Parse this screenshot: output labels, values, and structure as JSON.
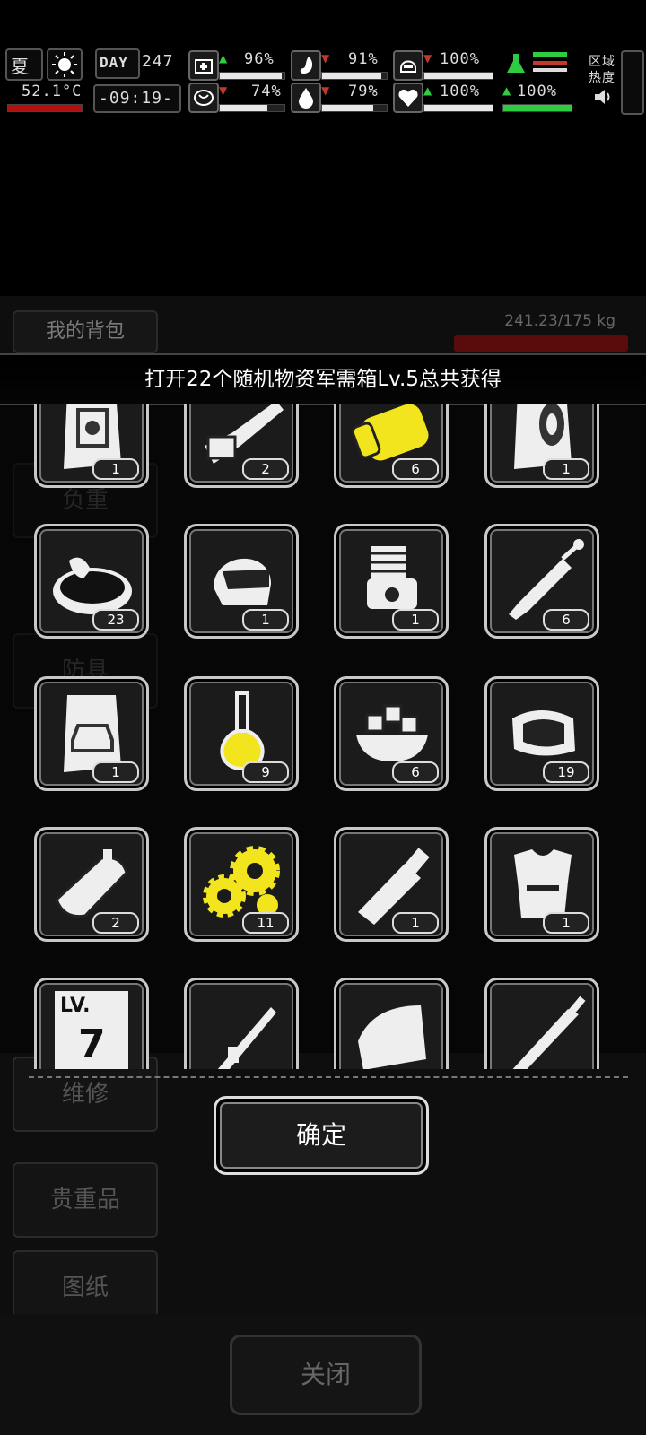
{
  "hud": {
    "season": "夏",
    "temperature": "52.1°C",
    "day_label": "DAY",
    "day_number": "247",
    "clock": "-09:19-",
    "stats": [
      {
        "name": "health",
        "icon": "medkit-icon",
        "value": "96%",
        "trend": "up",
        "color": "#e8e8e8",
        "level": 0.96
      },
      {
        "name": "hunger",
        "icon": "stomach-icon",
        "value": "91%",
        "trend": "down",
        "color": "#e8e8e8",
        "level": 0.91
      },
      {
        "name": "armor",
        "icon": "helmet-icon",
        "value": "100%",
        "trend": "down",
        "color": "#e8e8e8",
        "level": 1.0
      },
      {
        "name": "sanity",
        "icon": "brain-icon",
        "value": "74%",
        "trend": "down",
        "color": "#e8e8e8",
        "level": 0.74
      },
      {
        "name": "thirst",
        "icon": "water-drop-icon",
        "value": "79%",
        "trend": "down",
        "color": "#e8e8e8",
        "level": 0.79
      },
      {
        "name": "heart",
        "icon": "heart-icon",
        "value": "100%",
        "trend": "up",
        "color": "#e8e8e8",
        "level": 1.0
      },
      {
        "name": "infection",
        "icon": "flask-icon",
        "value": "100%",
        "trend": "up",
        "color": "#2ecc40",
        "level": 1.0
      }
    ],
    "zone_heat_label": "区域热度",
    "temperature_bar_color": "#b01010"
  },
  "background": {
    "backpack_title": "我的背包",
    "weight": "241.23/175 kg",
    "side_tabs": [
      "负重",
      "防具",
      "维修",
      "贵重品",
      "图纸"
    ],
    "close_label": "关闭"
  },
  "reward": {
    "header": "打开22个随机物资军需箱Lv.5总共获得",
    "confirm_label": "确定",
    "items": [
      {
        "icon": "engine-blueprint-icon",
        "qty": "1"
      },
      {
        "icon": "chainsaw-icon",
        "qty": "2"
      },
      {
        "icon": "yellow-cylinder-icon",
        "qty": "6"
      },
      {
        "icon": "tire-blueprint-icon",
        "qty": "1"
      },
      {
        "icon": "chicken-stew-icon",
        "qty": "23"
      },
      {
        "icon": "motorcycle-helmet-icon",
        "qty": "1"
      },
      {
        "icon": "engine-block-icon",
        "qty": "1"
      },
      {
        "icon": "syringe-icon",
        "qty": "6"
      },
      {
        "icon": "car-blueprint-icon",
        "qty": "1"
      },
      {
        "icon": "chemical-flask-icon",
        "qty": "9"
      },
      {
        "icon": "food-bowl-icon",
        "qty": "6"
      },
      {
        "icon": "raw-meat-icon",
        "qty": "19"
      },
      {
        "icon": "sardine-can-icon",
        "qty": "2"
      },
      {
        "icon": "gears-icon",
        "qty": "11"
      },
      {
        "icon": "fuel-nozzle-icon",
        "qty": "1"
      },
      {
        "icon": "body-armor-icon",
        "qty": "1"
      },
      {
        "icon": "level-card-icon",
        "qty": ""
      },
      {
        "icon": "rifle-icon",
        "qty": ""
      },
      {
        "icon": "shield-plate-icon",
        "qty": ""
      },
      {
        "icon": "machete-icon",
        "qty": ""
      }
    ],
    "level_card_text": "LV.",
    "level_card_number": "7"
  }
}
